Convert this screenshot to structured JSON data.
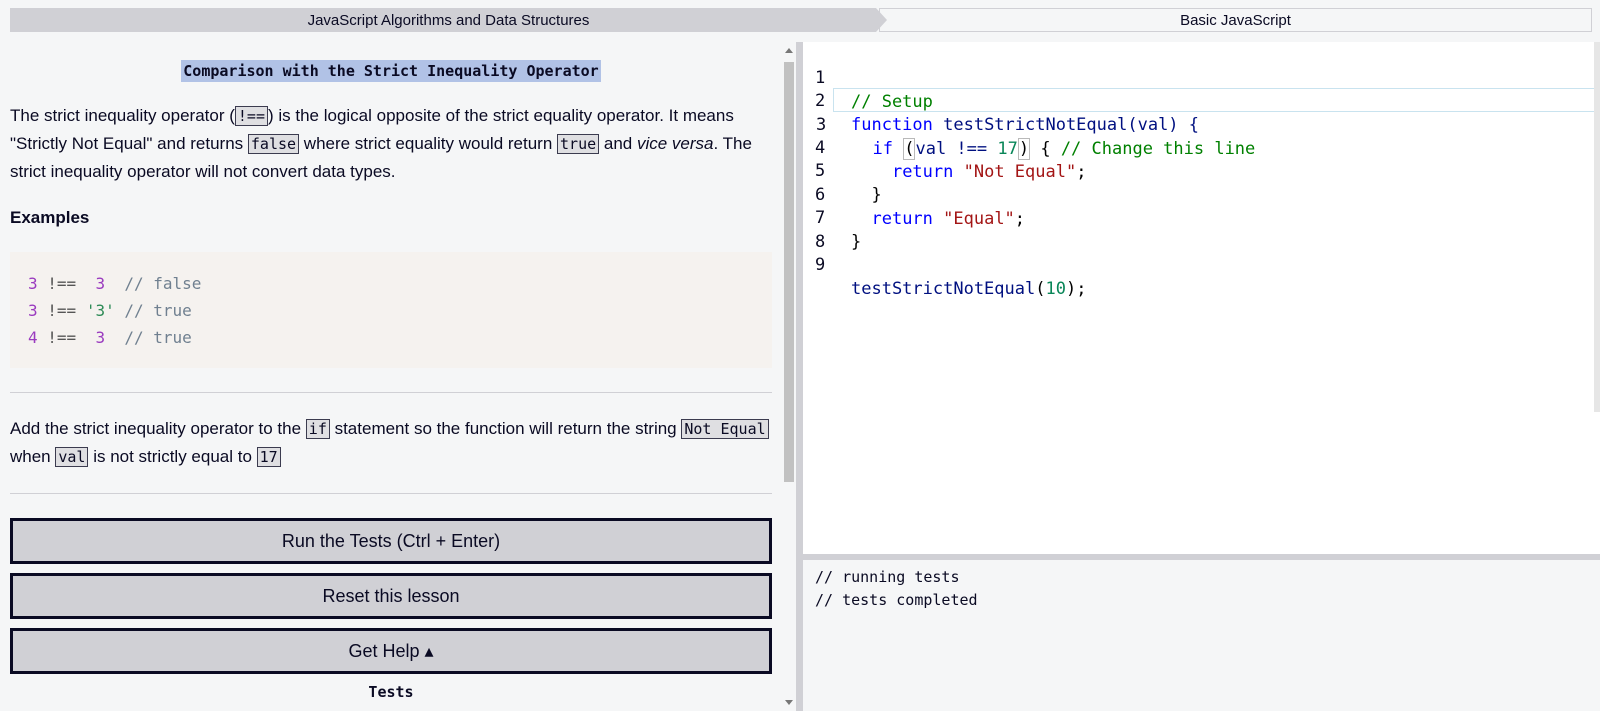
{
  "breadcrumb": {
    "superblock": "JavaScript Algorithms and Data Structures",
    "block": "Basic JavaScript"
  },
  "challenge": {
    "title": "Comparison with the Strict Inequality Operator",
    "desc_p1": "The strict inequality operator (",
    "desc_code1": "!==",
    "desc_p2": ") is the logical opposite of the strict equality operator. It means \"Strictly Not Equal\" and returns ",
    "desc_code2": "false",
    "desc_p3": " where strict equality would return ",
    "desc_code3": "true",
    "desc_p4": " and ",
    "desc_em": "vice versa",
    "desc_p5": ". The strict inequality operator will not convert data types.",
    "examples_heading": "Examples",
    "examples": [
      {
        "left": "3",
        "op": " !==  ",
        "right": "3",
        "right_type": "num",
        "comment": "  // false"
      },
      {
        "left": "3",
        "op": " !== ",
        "right": "'3'",
        "right_type": "str",
        "comment": " // true"
      },
      {
        "left": "4",
        "op": " !==  ",
        "right": "3",
        "right_type": "num",
        "comment": "  // true"
      }
    ],
    "task_p1": "Add the strict inequality operator to the ",
    "task_code1": "if",
    "task_p2": " statement so the function will return the string ",
    "task_code2": "Not Equal",
    "task_p3": " when ",
    "task_code3": "val",
    "task_p4": " is not strictly equal to ",
    "task_code4": "17",
    "run_button": "Run the Tests (Ctrl + Enter)",
    "reset_button": "Reset this lesson",
    "help_button": "Get Help ▴",
    "tests_heading": "Tests"
  },
  "editor": {
    "line_numbers": [
      "1",
      "2",
      "3",
      "4",
      "5",
      "6",
      "7",
      "8",
      "9"
    ],
    "l1_comment": "// Setup",
    "l2_kw": "function",
    "l2_name": " testStrictNotEqual",
    "l2_rest": "(val) {",
    "l3_indent": "  ",
    "l3_kw": "if",
    "l3_sp": " ",
    "l3_paren_open": "(",
    "l3_mid": "val !== ",
    "l3_num": "17",
    "l3_paren_close": ")",
    "l3_brace": " { ",
    "l3_comment": "// Change this line",
    "l4_indent": "    ",
    "l4_kw": "return",
    "l4_str": " \"Not Equal\"",
    "l4_end": ";",
    "l5": "  }",
    "l6_indent": "  ",
    "l6_kw": "return",
    "l6_str": " \"Equal\"",
    "l6_end": ";",
    "l7": "}",
    "l9_name": "testStrictNotEqual",
    "l9_open": "(",
    "l9_num": "10",
    "l9_close": ");"
  },
  "console": {
    "line1": "// running tests",
    "line2": "// tests completed"
  }
}
